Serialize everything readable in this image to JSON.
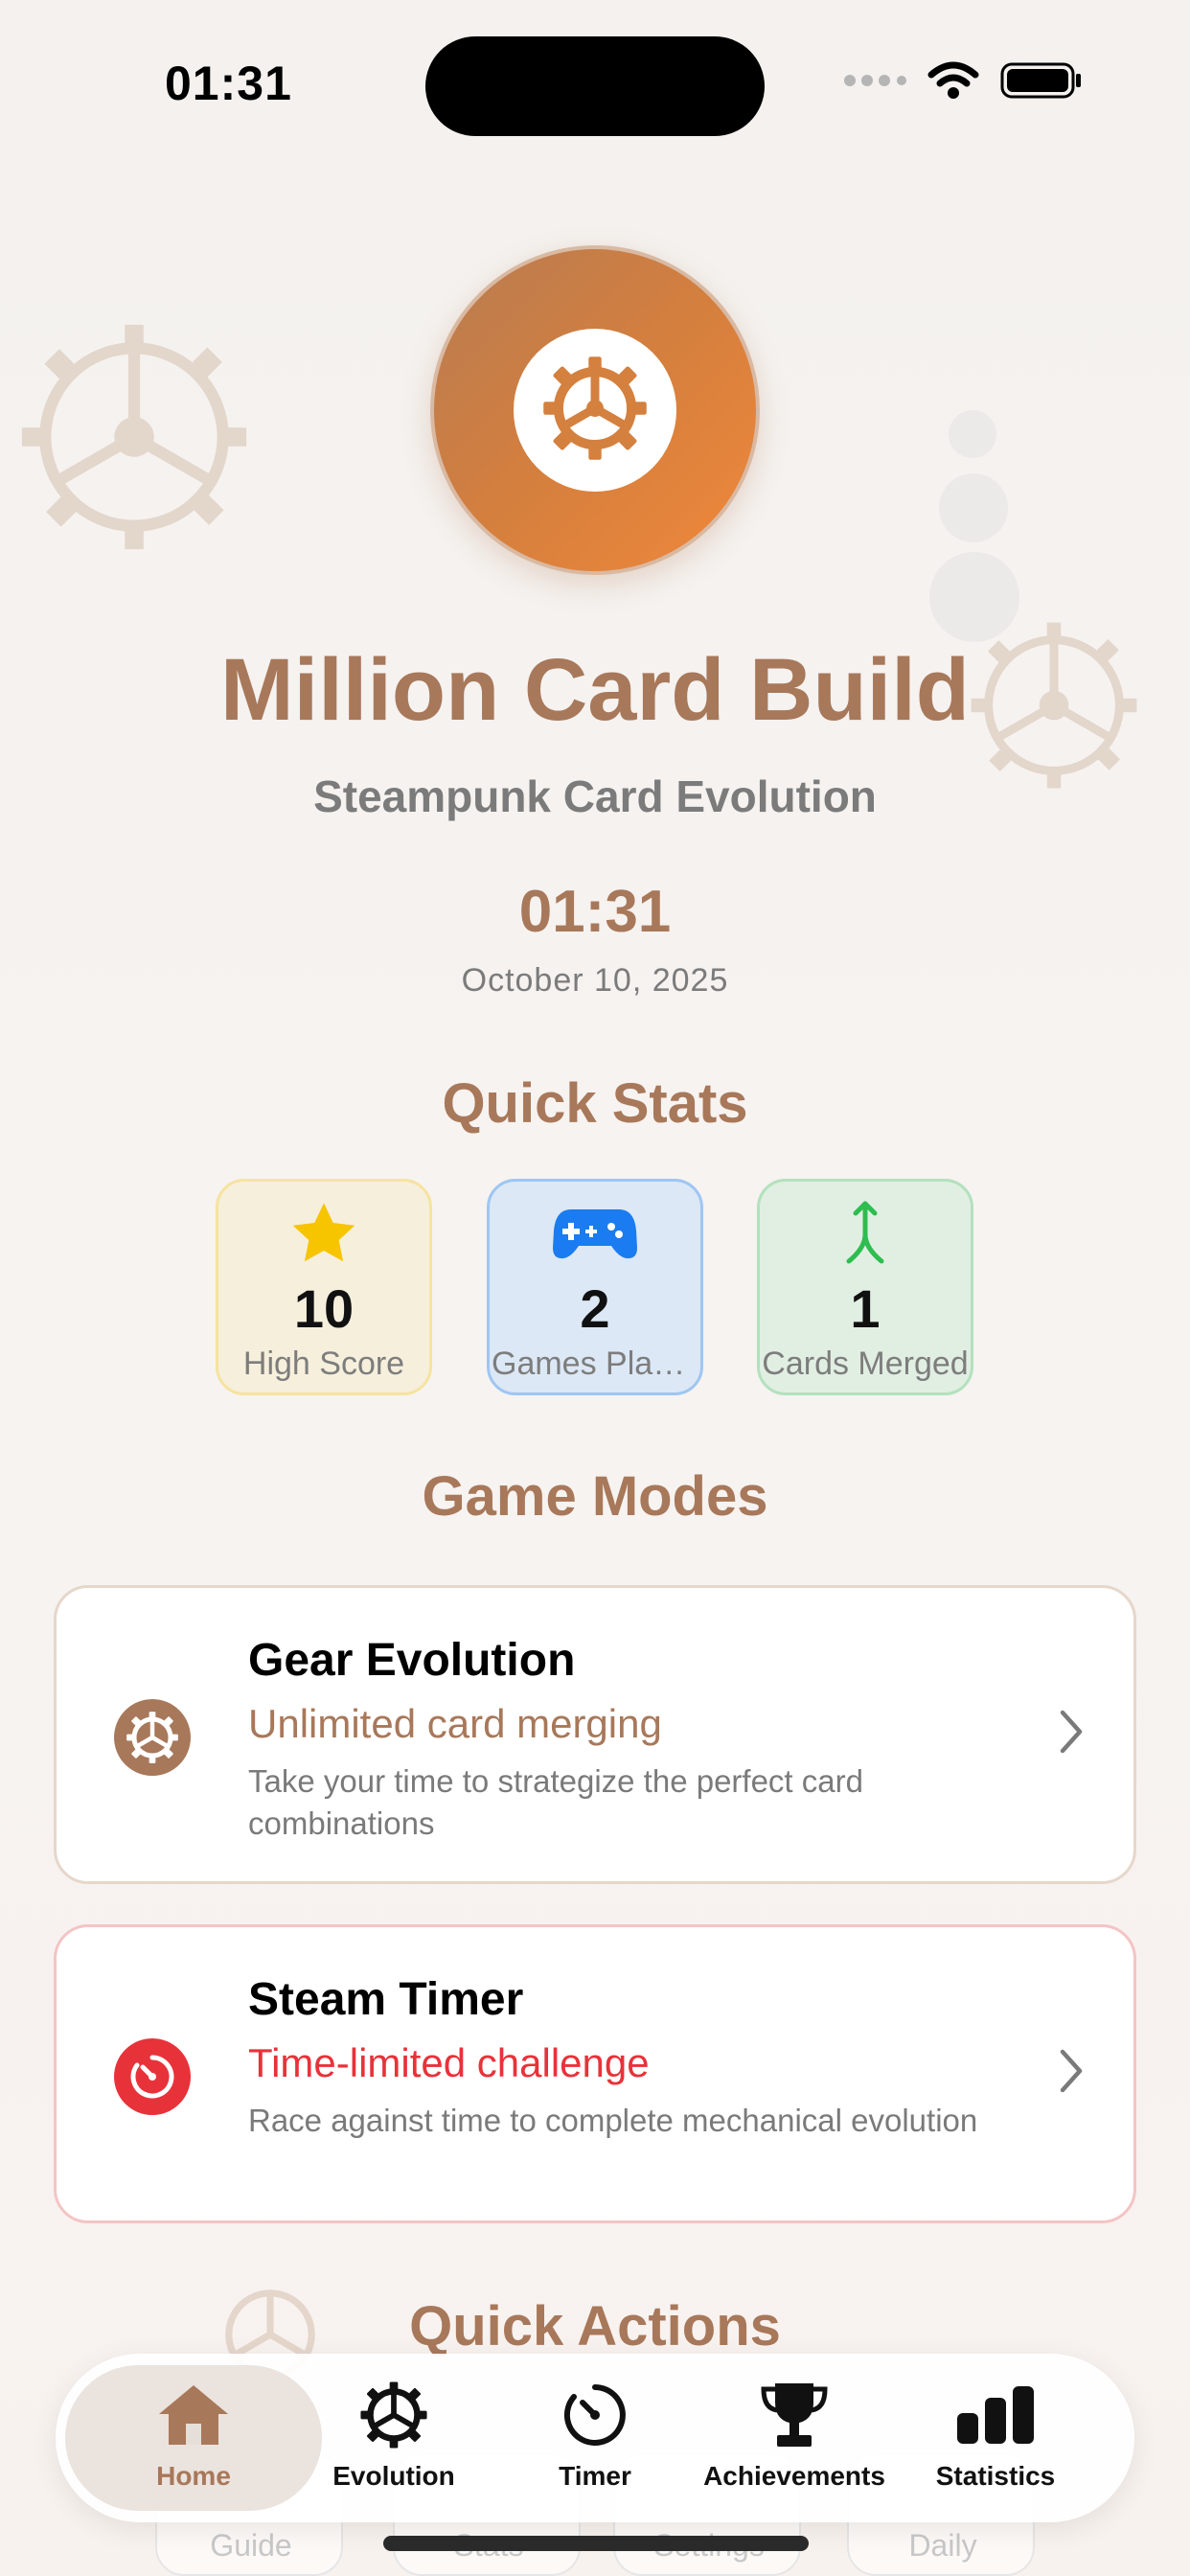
{
  "status_bar": {
    "time": "01:31"
  },
  "hero": {
    "title": "Million Card Build",
    "subtitle": "Steampunk Card Evolution",
    "time": "01:31",
    "date": "October 10, 2025"
  },
  "quick_stats": {
    "title": "Quick Stats",
    "items": [
      {
        "value": "10",
        "label": "High Score",
        "icon": "star-icon"
      },
      {
        "value": "2",
        "label": "Games Played",
        "icon": "gamecontroller-icon"
      },
      {
        "value": "1",
        "label": "Cards Merged",
        "icon": "merge-arrow-icon"
      }
    ]
  },
  "game_modes": {
    "title": "Game Modes",
    "items": [
      {
        "title": "Gear Evolution",
        "subtitle": "Unlimited card merging",
        "description": "Take your time to strategize the perfect card combinations",
        "icon": "gear-icon",
        "accent": "#a8785a"
      },
      {
        "title": "Steam Timer",
        "subtitle": "Time-limited challenge",
        "description": "Race against time to complete mechanical evolution",
        "icon": "timer-icon",
        "accent": "#e8323a"
      }
    ]
  },
  "quick_actions": {
    "title": "Quick Actions",
    "items": [
      "Guide",
      "Stats",
      "Settings",
      "Daily"
    ]
  },
  "tab_bar": {
    "active": "Home",
    "items": [
      {
        "label": "Home",
        "icon": "house-icon"
      },
      {
        "label": "Evolution",
        "icon": "gear-icon"
      },
      {
        "label": "Timer",
        "icon": "timer-icon"
      },
      {
        "label": "Achievements",
        "icon": "trophy-icon"
      },
      {
        "label": "Statistics",
        "icon": "chart-bars-icon"
      }
    ]
  },
  "colors": {
    "brand": "#a8785a",
    "accent_orange": "#f0883a",
    "danger": "#e8323a"
  }
}
